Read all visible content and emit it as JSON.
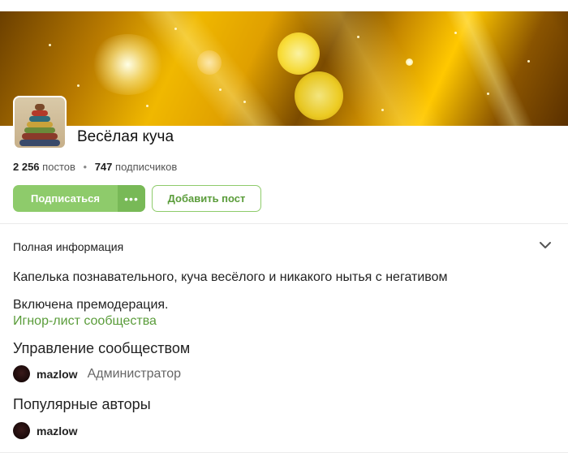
{
  "community": {
    "name": "Весёлая куча",
    "posts_count": "2 256",
    "posts_label": "постов",
    "subscribers_count": "747",
    "subscribers_label": "подписчиков"
  },
  "actions": {
    "subscribe_label": "Подписаться",
    "more_label": "•••",
    "add_post_label": "Добавить пост"
  },
  "info": {
    "section_title": "Полная информация",
    "description": "Капелька познавательного, куча весёлого и никакого нытья с негативом",
    "premoderation": "Включена премодерация.",
    "ignore_list_link": "Игнор-лист сообщества"
  },
  "management": {
    "title": "Управление сообществом",
    "members": [
      {
        "name": "mazlow",
        "role": "Администратор"
      }
    ]
  },
  "popular_authors": {
    "title": "Популярные авторы",
    "members": [
      {
        "name": "mazlow"
      }
    ]
  },
  "colors": {
    "accent_green": "#8ecb6b",
    "accent_green_dark": "#78b957",
    "link_green": "#5a9c3a"
  }
}
